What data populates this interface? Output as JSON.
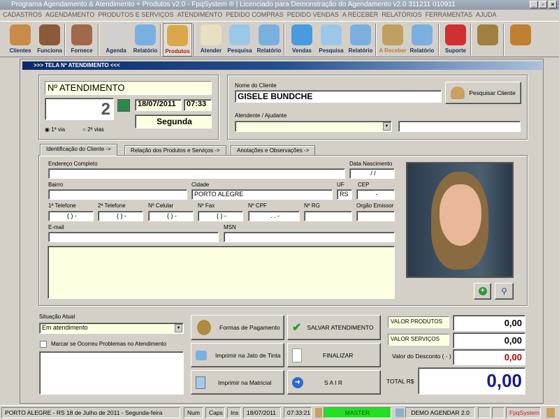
{
  "window": {
    "title": "Programa Agendamento & Atendimento + Produtos v2.0 - FpqSystem ® | Licenciado para  Demonstração do Agendamento v2.0 311211 010911"
  },
  "menu": [
    "CADASTROS",
    "AGENDAMENTO",
    "PRODUTOS E SERVIÇOS",
    "ATENDIMENTO",
    "PEDIDO COMPRAS",
    "PEDIDO VENDAS",
    "A RECEBER",
    "RELATÓRIOS",
    "FERRAMENTAS",
    "AJUDA"
  ],
  "toolbar": [
    {
      "label": "Clientes",
      "icon": "users-icon",
      "color": "#c98a4a"
    },
    {
      "label": "Funciona",
      "icon": "employee-icon",
      "color": "#8a5a3a"
    },
    {
      "label": "Fornece",
      "icon": "supplier-icon",
      "color": "#a06a4a"
    },
    {
      "label": "Agenda",
      "icon": "clock-calendar-icon",
      "color": "#d0d0d0"
    },
    {
      "label": "Relatório",
      "icon": "printer-icon",
      "color": "#7ab0e0"
    },
    {
      "label": "Produtos",
      "icon": "boxes-icon",
      "color": "#d9a84a"
    },
    {
      "label": "Atender",
      "icon": "notepad-icon",
      "color": "#e8e0c0"
    },
    {
      "label": "Pesquisa",
      "icon": "search-doc-icon",
      "color": "#9cc8e8"
    },
    {
      "label": "Relatório",
      "icon": "printer-icon",
      "color": "#7ab0e0"
    },
    {
      "label": "Vendas",
      "icon": "monitor-icon",
      "color": "#4a9ae0"
    },
    {
      "label": "Pesquisa",
      "icon": "search-doc-icon",
      "color": "#9cc8e8"
    },
    {
      "label": "Relatório",
      "icon": "printer-icon",
      "color": "#7ab0e0"
    },
    {
      "label": "A Receber",
      "icon": "money-icon",
      "color": "#c0a060"
    },
    {
      "label": "Relatório",
      "icon": "printer-icon",
      "color": "#7ab0e0"
    },
    {
      "label": "Suporte",
      "icon": "support-icon",
      "color": "#d03030"
    },
    {
      "label": "",
      "icon": "coin-icon",
      "color": "#a08040"
    },
    {
      "label": "",
      "icon": "exit-door-icon",
      "color": "#c08030"
    }
  ],
  "screen_title": ">>>  TELA Nº ATENDIMENTO   <<<",
  "atendimento": {
    "label": "Nº ATENDIMENTO",
    "number": "2",
    "date": "18/07/2011",
    "time": "07:33",
    "weekday": "Segunda",
    "via1": "1ª via",
    "via2": "2ª vias"
  },
  "cliente": {
    "label": "Nome do Cliente",
    "value": "GISELE BUNDCHE",
    "search_button": "Pesquisar Cliente",
    "atendente_label": "Atendente / Ajudante",
    "atendente_value": "",
    "atendente_extra": ""
  },
  "tabs": [
    "Identificação do Cliente ->",
    "Relação dos Produtos e Serviços ->",
    "Anotações e Observações ->"
  ],
  "form": {
    "endereco_label": "Endereço Completo",
    "endereco": "",
    "nascimento_label": "Data Nascimento",
    "nascimento": " / /",
    "bairro_label": "Bairro",
    "bairro": "",
    "cidade_label": "Cidade",
    "cidade": "PORTO ALEGRE",
    "uf_label": "UF",
    "uf": "RS",
    "cep_label": "CEP",
    "cep": "-",
    "tel1_label": "1ª Telefone",
    "tel1": "( )  -",
    "tel2_label": "2ª Telefone",
    "tel2": "( )  -",
    "cel_label": "Nº Celular",
    "cel": "( )  -",
    "fax_label": "Nº Fax",
    "fax": "( )  -",
    "cpf_label": "Nº CPF",
    "cpf": ". .  -",
    "rg_label": "Nº RG",
    "rg": "",
    "orgao_label": "Orgão Emissor",
    "orgao": "",
    "email_label": "E-mail",
    "email": "",
    "msn_label": "MSN",
    "msn": ""
  },
  "situacao": {
    "label": "Situação Atual",
    "value": "Em atendimento",
    "checkbox": "Marcar se Ocorreu Problemas no Atendimento",
    "checked": false
  },
  "buttons": {
    "pagamento": "Formas de Pagamento",
    "salvar": "SALVAR  ATENDIMENTO",
    "jato": "Imprimir na Jato de Tinta",
    "finalizar": "FINALIZAR",
    "matricial": "Imprimir na Matricial",
    "sair": "S A I R"
  },
  "totais": {
    "produtos_label": "VALOR PRODUTOS",
    "produtos": "0,00",
    "servicos_label": "VALOR SERVIÇOS",
    "servicos": "0,00",
    "desconto_label": "Valor do Desconto ( - )",
    "desconto": "0,00",
    "total_label": "TOTAL R$",
    "total": "0,00"
  },
  "status": {
    "location": "PORTO ALEGRE - RS 18 de Julho de 2011 - Segunda-feira",
    "num": "Num",
    "caps": "Caps",
    "ins": "Ins",
    "date": "18/07/2011",
    "time": "07:33:21",
    "user": "MASTER",
    "db": "DEMO AGENDAR 2.0",
    "brand": "FpqSystem"
  }
}
